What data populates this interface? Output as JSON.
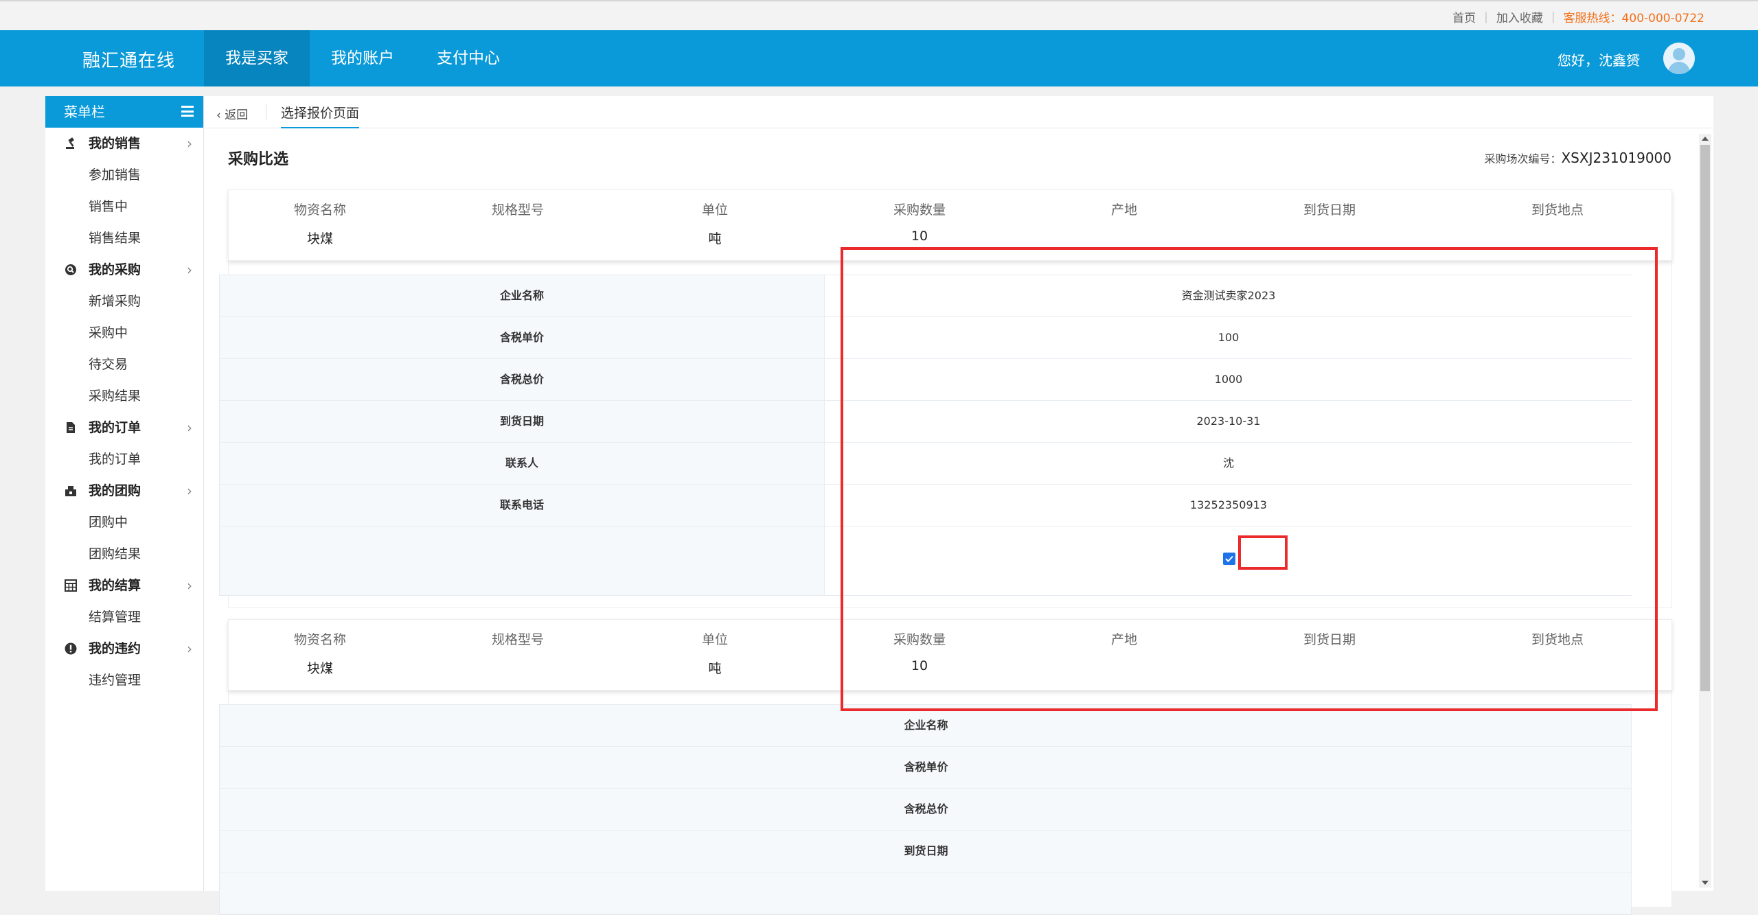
{
  "topbar": {
    "home": "首页",
    "favorite": "加入收藏",
    "hotline": "客服热线：400-000-0722"
  },
  "header": {
    "brand": "融汇通在线",
    "tabs": [
      {
        "label": "我是买家",
        "active": true
      },
      {
        "label": "我的账户",
        "active": false
      },
      {
        "label": "支付中心",
        "active": false
      }
    ],
    "greeting": "您好，沈鑫赟"
  },
  "sidebar": {
    "title": "菜单栏",
    "groups": [
      {
        "label": "我的销售",
        "icon": "auction-icon",
        "items": [
          "参加销售",
          "销售中",
          "销售结果"
        ]
      },
      {
        "label": "我的采购",
        "icon": "search-icon",
        "items": [
          "新增采购",
          "采购中",
          "待交易",
          "采购结果"
        ]
      },
      {
        "label": "我的订单",
        "icon": "document-icon",
        "items": [
          "我的订单"
        ]
      },
      {
        "label": "我的团购",
        "icon": "group-icon",
        "items": [
          "团购中",
          "团购结果"
        ]
      },
      {
        "label": "我的结算",
        "icon": "calculator-icon",
        "items": [
          "结算管理"
        ]
      },
      {
        "label": "我的违约",
        "icon": "warning-icon",
        "items": [
          "违约管理"
        ]
      }
    ]
  },
  "breadcrumb": {
    "back": "返回",
    "page": "选择报价页面"
  },
  "main": {
    "title": "采购比选",
    "serial_label": "采购场次编号：",
    "serial_value": "XSXJ231019000",
    "columns": [
      "物资名称",
      "规格型号",
      "单位",
      "采购数量",
      "产地",
      "到货日期",
      "到货地点"
    ],
    "blocks": [
      {
        "item": {
          "name": "块煤",
          "spec": "",
          "unit": "吨",
          "qty": "10",
          "origin": "",
          "date": "",
          "place": ""
        },
        "quote": {
          "labels": [
            "企业名称",
            "含税单价",
            "含税总价",
            "到货日期",
            "联系人",
            "联系电话"
          ],
          "values": [
            "资金测试卖家2023",
            "100",
            "1000",
            "2023-10-31",
            "沈",
            "13252350913"
          ],
          "selected": true
        }
      },
      {
        "item": {
          "name": "块煤",
          "spec": "",
          "unit": "吨",
          "qty": "10",
          "origin": "",
          "date": "",
          "place": ""
        },
        "quote": {
          "labels": [
            "企业名称",
            "含税单价",
            "含税总价",
            "到货日期"
          ]
        }
      }
    ]
  },
  "colors": {
    "header": "#0a9ad9",
    "header_active": "#0785bf",
    "hotline": "#f2711c",
    "highlight": "#ea2b2b",
    "checkbox": "#1e73e8"
  }
}
